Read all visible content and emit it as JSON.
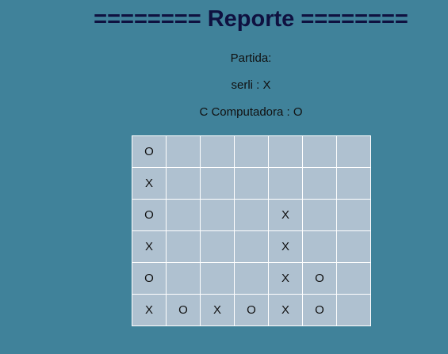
{
  "report": {
    "title": "======== Reporte ========",
    "match_label": "Partida:",
    "player_line": "serli : X",
    "computer_line": "C Computadora : O"
  },
  "board": {
    "rows": [
      [
        "O",
        "",
        "",
        "",
        "",
        "",
        ""
      ],
      [
        "X",
        "",
        "",
        "",
        "",
        "",
        ""
      ],
      [
        "O",
        "",
        "",
        "",
        "X",
        "",
        ""
      ],
      [
        "X",
        "",
        "",
        "",
        "X",
        "",
        ""
      ],
      [
        "O",
        "",
        "",
        "",
        "X",
        "O",
        ""
      ],
      [
        "X",
        "O",
        "X",
        "O",
        "X",
        "O",
        ""
      ]
    ]
  }
}
